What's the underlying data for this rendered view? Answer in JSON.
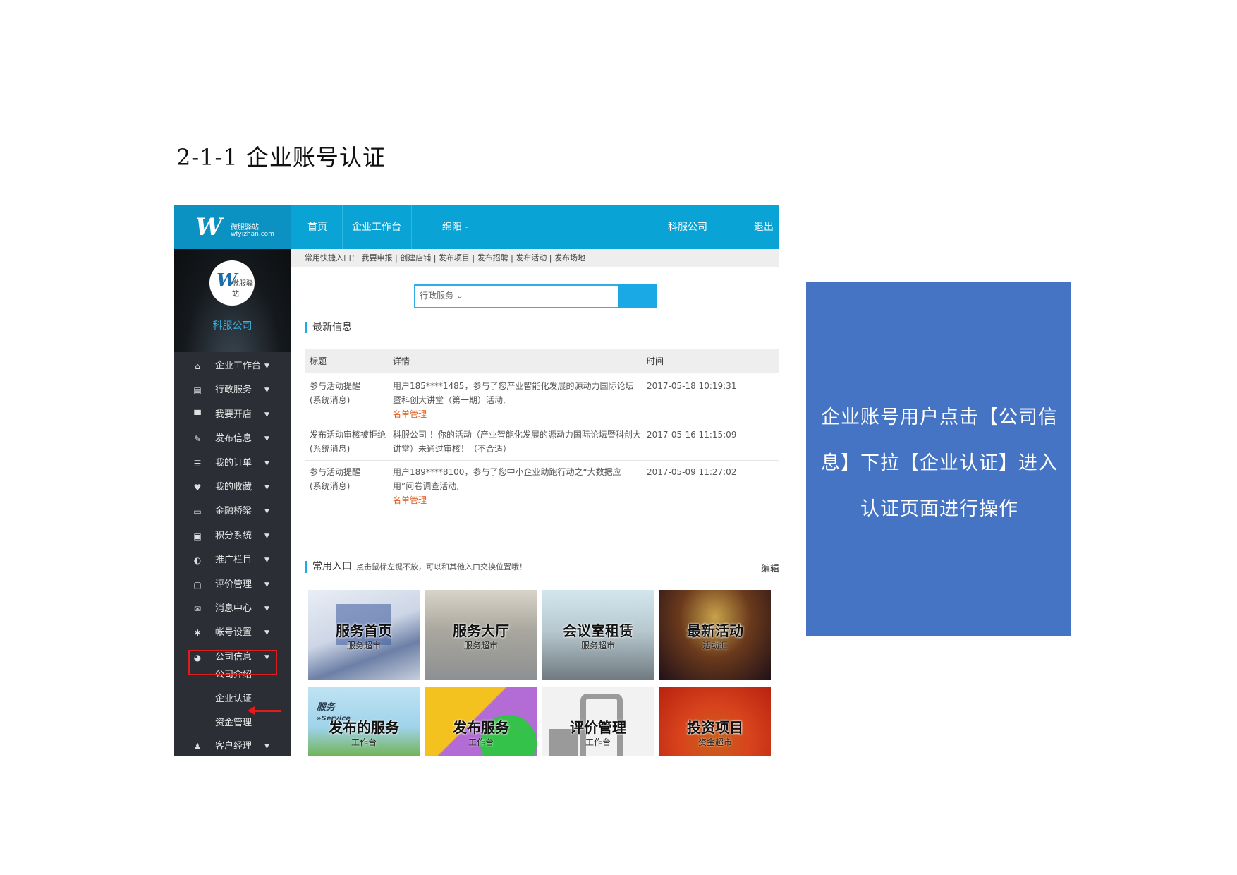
{
  "heading": "2-1-1 企业账号认证",
  "topbar": {
    "logo_mark": "W",
    "logo_cn": "微服驿站",
    "logo_en": "wfyizhan.com",
    "nav": [
      "首页",
      "企业工作台",
      "绵阳 -",
      "科服公司",
      "退出"
    ]
  },
  "sidebar": {
    "company": "科服公司",
    "avatar_text": "微服驿站",
    "menu": [
      {
        "label": "企业工作台",
        "icon": "home-icon",
        "glyph": "⌂"
      },
      {
        "label": "行政服务",
        "icon": "document-icon",
        "glyph": "▤"
      },
      {
        "label": "我要开店",
        "icon": "store-icon",
        "glyph": "▀"
      },
      {
        "label": "发布信息",
        "icon": "pencil-icon",
        "glyph": "✎"
      },
      {
        "label": "我的订单",
        "icon": "list-icon",
        "glyph": "☰"
      },
      {
        "label": "我的收藏",
        "icon": "heart-icon",
        "glyph": "♥"
      },
      {
        "label": "金融桥梁",
        "icon": "card-icon",
        "glyph": "▭"
      },
      {
        "label": "积分系统",
        "icon": "gift-icon",
        "glyph": "▣"
      },
      {
        "label": "推广栏目",
        "icon": "shield-icon",
        "glyph": "◐"
      },
      {
        "label": "评价管理",
        "icon": "comment-icon",
        "glyph": "▢"
      },
      {
        "label": "消息中心",
        "icon": "mail-icon",
        "glyph": "✉"
      },
      {
        "label": "帐号设置",
        "icon": "gear-icon",
        "glyph": "✱"
      },
      {
        "label": "公司信息",
        "icon": "pie-chart-icon",
        "glyph": "◕"
      }
    ],
    "submenu": [
      "公司介绍",
      "企业认证",
      "资金管理"
    ],
    "last_item": {
      "label": "客户经理",
      "icon": "user-icon",
      "glyph": "♟"
    }
  },
  "quickbar": "常用快捷入口： 我要申报 | 创建店铺 | 发布项目 | 发布招聘 | 发布活动 | 发布场地",
  "search": {
    "select": "行政服务 ⌄"
  },
  "latest": {
    "title": "最新信息",
    "columns": [
      "标题",
      "详情",
      "时间"
    ],
    "rows": [
      {
        "title": "参与活动提醒",
        "source": "(系统消息)",
        "detail": "用户185****1485，参与了您产业智能化发展的源动力国际论坛暨科创大讲堂（第一期）活动,",
        "link": "名单管理",
        "time": "2017-05-18 10:19:31"
      },
      {
        "title": "发布活动审核被拒绝",
        "source": "(系统消息)",
        "detail": "科服公司 ！你的活动（产业智能化发展的源动力国际论坛暨科创大讲堂）未通过审核！（不合适）",
        "link": "",
        "time": "2017-05-16 11:15:09"
      },
      {
        "title": "参与活动提醒",
        "source": "(系统消息)",
        "detail": "用户189****8100，参与了您中小企业助跑行动之“大数据应用”问卷调查活动,",
        "link": "名单管理",
        "time": "2017-05-09 11:27:02"
      }
    ]
  },
  "common": {
    "title": "常用入口",
    "tip": "点击鼠标左键不放，可以和其他入口交换位置哦！",
    "edit": "编辑",
    "tiles": [
      {
        "title": "服务首页",
        "sub": "服务超市"
      },
      {
        "title": "服务大厅",
        "sub": "服务超市"
      },
      {
        "title": "会议室租赁",
        "sub": "服务超市"
      },
      {
        "title": "最新活动",
        "sub": "活动汇"
      },
      {
        "title": "发布的服务",
        "sub": "工作台",
        "badge": "服务\n»Service"
      },
      {
        "title": "发布服务",
        "sub": "工作台"
      },
      {
        "title": "评价管理",
        "sub": "工作台"
      },
      {
        "title": "投资项目",
        "sub": "资金超市"
      }
    ]
  },
  "callout": "企业账号用户点击【公司信息】下拉【企业认证】进入认证页面进行操作",
  "colors": {
    "topbar": "#0aa3d6",
    "sidebar": "#2b2f35",
    "callout": "#4674c4",
    "highlight": "#e21b1b",
    "link": "#e2591a"
  }
}
